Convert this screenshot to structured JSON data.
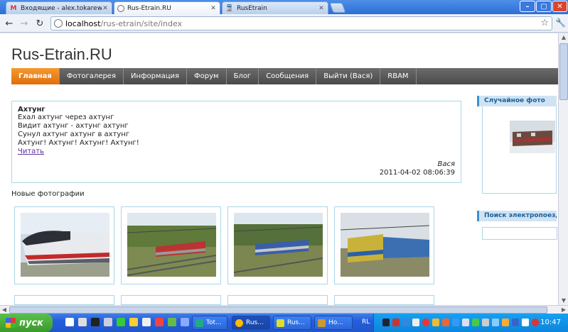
{
  "browser": {
    "tabs": [
      {
        "label": "Входящие - alex.tokarew@gm",
        "icon": "gmail-icon"
      },
      {
        "label": "Rus-Etrain.RU",
        "icon": "globe-icon",
        "active": true
      },
      {
        "label": "RusEtrain",
        "icon": "train-icon"
      }
    ],
    "address": {
      "host": "localhost",
      "path": "/rus-etrain/site/index"
    }
  },
  "site": {
    "title": "Rus-Etrain.RU",
    "menu": [
      "Главная",
      "Фотогалерея",
      "Информация",
      "Форум",
      "Блог",
      "Сообщения",
      "Выйти (Вася)",
      "RBAM"
    ],
    "post": {
      "title": "Ахтунг",
      "lines": [
        "Ехал ахтунг через ахтунг",
        "Видит ахтунг - ахтунг ахтунг",
        "Сунул ахтунг ахтунг в ахтунг",
        "Ахтунг! Ахтунг! Ахтунг! Ахтунг!"
      ],
      "read_link": "Читать",
      "author": "Вася",
      "date": "2011-04-02 08:06:39"
    },
    "new_photos_label": "Новые фотографии",
    "sidebar": {
      "random_photo_title": "Случайное фото",
      "search_title": "Поиск электропоезда"
    }
  },
  "taskbar": {
    "start_label": "пуск",
    "tasks": [
      "Tot...",
      "Rus...",
      "Rus...",
      "Ho..."
    ],
    "lang": "RL",
    "clock": "10:47"
  },
  "colors": {
    "menu_active": "#e36d0d",
    "card_border": "#a9d7e8",
    "sidebar_accent": "#3a92d0"
  }
}
